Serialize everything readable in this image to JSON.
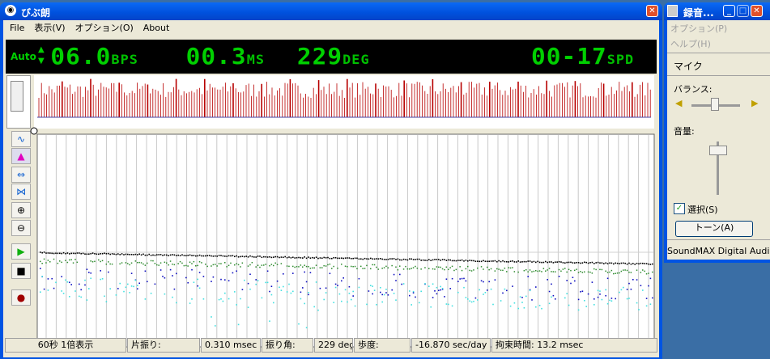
{
  "main_window": {
    "title": "びぶ朗",
    "close_glyph": "✕",
    "menu": [
      "File",
      "表示(V)",
      "オプション(O)",
      "About"
    ],
    "lcd": {
      "mode": "Auto",
      "bps_value": "06.0",
      "bps_unit": "BPS",
      "ms_value": "00.3",
      "ms_unit": "MS",
      "deg_value": "229",
      "deg_unit": "DEG",
      "spd_value": "00-17",
      "spd_unit": "SPD"
    },
    "status": {
      "display": "60秒 1倍表示",
      "amp_label": "片振り:",
      "amp_value": "0.310 msec",
      "angle_label": "振り角:",
      "angle_value": "229 deg",
      "rate_label": "歩度:",
      "rate_value": "-16.870 sec/day",
      "lock_label": "拘束時間: 13.2 msec"
    }
  },
  "recorder_window": {
    "title": "録音...",
    "menu": [
      "オプション(P)",
      "ヘルプ(H)"
    ],
    "section": "マイク",
    "balance_label": "バランス:",
    "volume_label": "音量:",
    "select_label": "選択(S)",
    "tone_button": "トーン(A)",
    "device": "SoundMAX Digital Audio"
  },
  "colors": {
    "titlebar": "#0054e3",
    "lcd_green": "#00d000",
    "wave": "#b80000",
    "trace_black": "#000000",
    "trace_green": "#2e8b2e",
    "trace_blue": "#1010c0",
    "trace_cyan": "#40e0e0"
  }
}
